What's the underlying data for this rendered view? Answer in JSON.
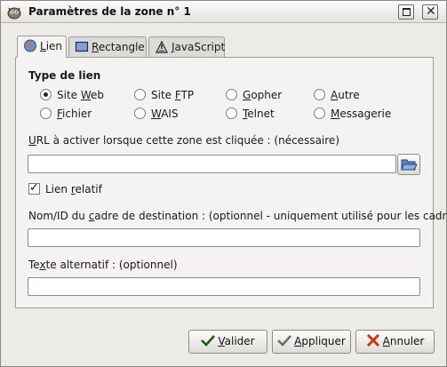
{
  "window": {
    "title": "Paramètres de la zone n° 1",
    "icon": "gimp-icon",
    "controls": [
      "maximize-icon",
      "close-icon"
    ]
  },
  "tabs": [
    {
      "pre": "",
      "mn": "L",
      "post": "ien",
      "icon": "globe-icon",
      "active": true
    },
    {
      "pre": "",
      "mn": "R",
      "post": "ectangle",
      "icon": "rectangle-icon",
      "active": false
    },
    {
      "pre": "",
      "mn": "J",
      "post": "avaScript",
      "icon": "javascript-icon",
      "active": false
    }
  ],
  "link_type": {
    "heading": "Type de lien",
    "options": [
      {
        "pre": "Site ",
        "mn": "W",
        "post": "eb",
        "selected": true
      },
      {
        "pre": "Site ",
        "mn": "F",
        "post": "TP",
        "selected": false
      },
      {
        "pre": "",
        "mn": "G",
        "post": "opher",
        "selected": false
      },
      {
        "pre": "",
        "mn": "A",
        "post": "utre",
        "selected": false
      },
      {
        "pre": "",
        "mn": "F",
        "post": "ichier",
        "selected": false
      },
      {
        "pre": "",
        "mn": "W",
        "post": "AIS",
        "selected": false
      },
      {
        "pre": "",
        "mn": "T",
        "post": "elnet",
        "selected": false
      },
      {
        "pre": "",
        "mn": "M",
        "post": "essagerie",
        "selected": false
      }
    ]
  },
  "url": {
    "label_mn": "U",
    "label_rest": "RL à activer lorsque cette zone est cliquée : (nécessaire)",
    "value": ""
  },
  "relative": {
    "pre": "Lien ",
    "mn": "r",
    "post": "elatif",
    "checked": true
  },
  "target": {
    "label_pre": "Nom/ID du ",
    "label_mn": "c",
    "label_post": "adre de destination : (optionnel - uniquement utilisé pour les cadres)",
    "value": ""
  },
  "alt": {
    "label_pre": "Te",
    "label_mn": "x",
    "label_post": "te alternatif : (optionnel)",
    "value": ""
  },
  "buttons": {
    "ok": {
      "mn": "V",
      "post": "alider"
    },
    "apply": {
      "mn": "A",
      "post": "ppliquer"
    },
    "cancel": {
      "mn": "A",
      "post": "nnuler"
    }
  },
  "colors": {
    "accent_check": "#2e6a1e",
    "cancel_x": "#c63b16"
  }
}
